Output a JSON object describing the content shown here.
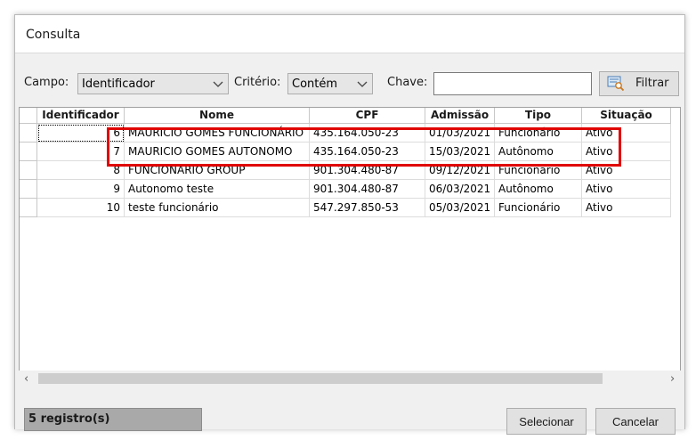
{
  "window": {
    "title": "Consulta"
  },
  "filters": {
    "campo_label": "Campo:",
    "campo_value": "Identificador",
    "criterio_label": "Critério:",
    "criterio_value": "Contém",
    "chave_label": "Chave:",
    "chave_value": "",
    "filter_button": "Filtrar"
  },
  "table": {
    "columns": [
      "Identificador",
      "Nome",
      "CPF",
      "Admissão",
      "Tipo",
      "Situação"
    ],
    "rows": [
      [
        "6",
        "MAURICIO GOMES FUNCIONÁRIO",
        "435.164.050-23",
        "01/03/2021",
        "Funcionário",
        "Ativo"
      ],
      [
        "7",
        "MAURICIO GOMES AUTONOMO",
        "435.164.050-23",
        "15/03/2021",
        "Autônomo",
        "Ativo"
      ],
      [
        "8",
        "FUNCIONARIO GROUP",
        "901.304.480-87",
        "09/12/2021",
        "Funcionário",
        "Ativo"
      ],
      [
        "9",
        "Autonomo teste",
        "901.304.480-87",
        "06/03/2021",
        "Autônomo",
        "Ativo"
      ],
      [
        "10",
        "teste funcionário",
        "547.297.850-53",
        "05/03/2021",
        "Funcionário",
        "Ativo"
      ]
    ]
  },
  "footer": {
    "status": "5 registro(s)",
    "select_button": "Selecionar",
    "cancel_button": "Cancelar"
  },
  "colors": {
    "highlight": "#e00000",
    "status_bg": "#a9a9a9"
  },
  "icons": {
    "filter": "filter-icon",
    "chevron": "chevron-down-icon",
    "scroll_left": "scroll-left-icon",
    "scroll_right": "scroll-right-icon"
  }
}
